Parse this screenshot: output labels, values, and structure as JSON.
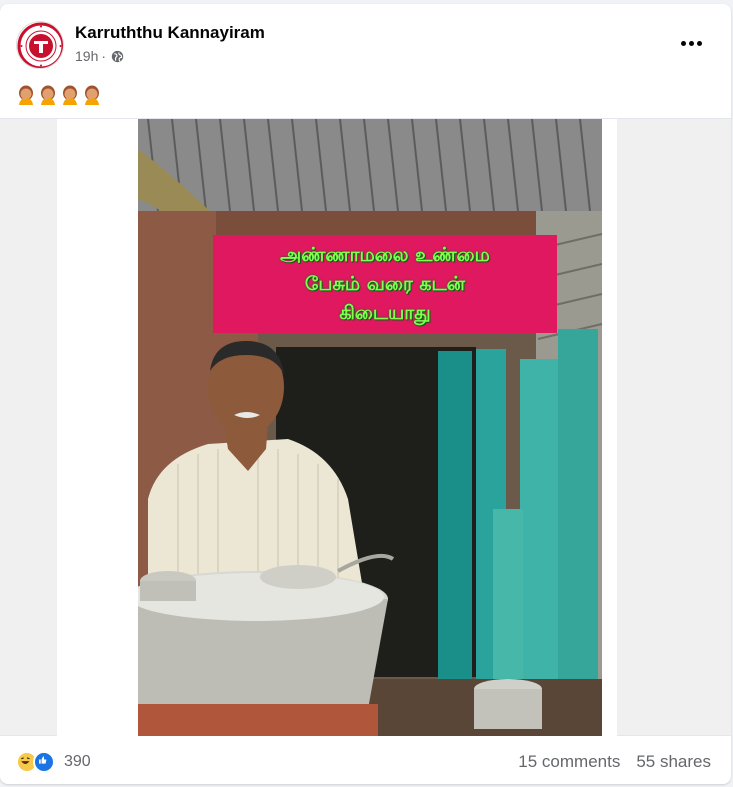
{
  "post": {
    "page_name": "Karruththu Kannayiram",
    "time": "19h",
    "separator": "·",
    "audience_icon": "globe-icon",
    "more_icon": "more-options-icon",
    "text_emojis": [
      "person-facepalming-emoji",
      "person-facepalming-emoji",
      "person-facepalming-emoji",
      "person-facepalming-emoji"
    ]
  },
  "image": {
    "sign_lines": [
      "அண்ணாமலை உண்மை",
      "பேசும் வரை கடன்",
      "கிடையாது"
    ],
    "sign_color": "#e0185f",
    "sign_text_color": "#7dff4f"
  },
  "footer": {
    "reaction_icons": [
      "haha-icon",
      "like-icon"
    ],
    "reaction_count": "390",
    "comments": "15 comments",
    "shares": "55 shares"
  },
  "colors": {
    "secondary_text": "#65676b",
    "like_blue": "#1b74e4",
    "background": "#f0f2f5"
  }
}
